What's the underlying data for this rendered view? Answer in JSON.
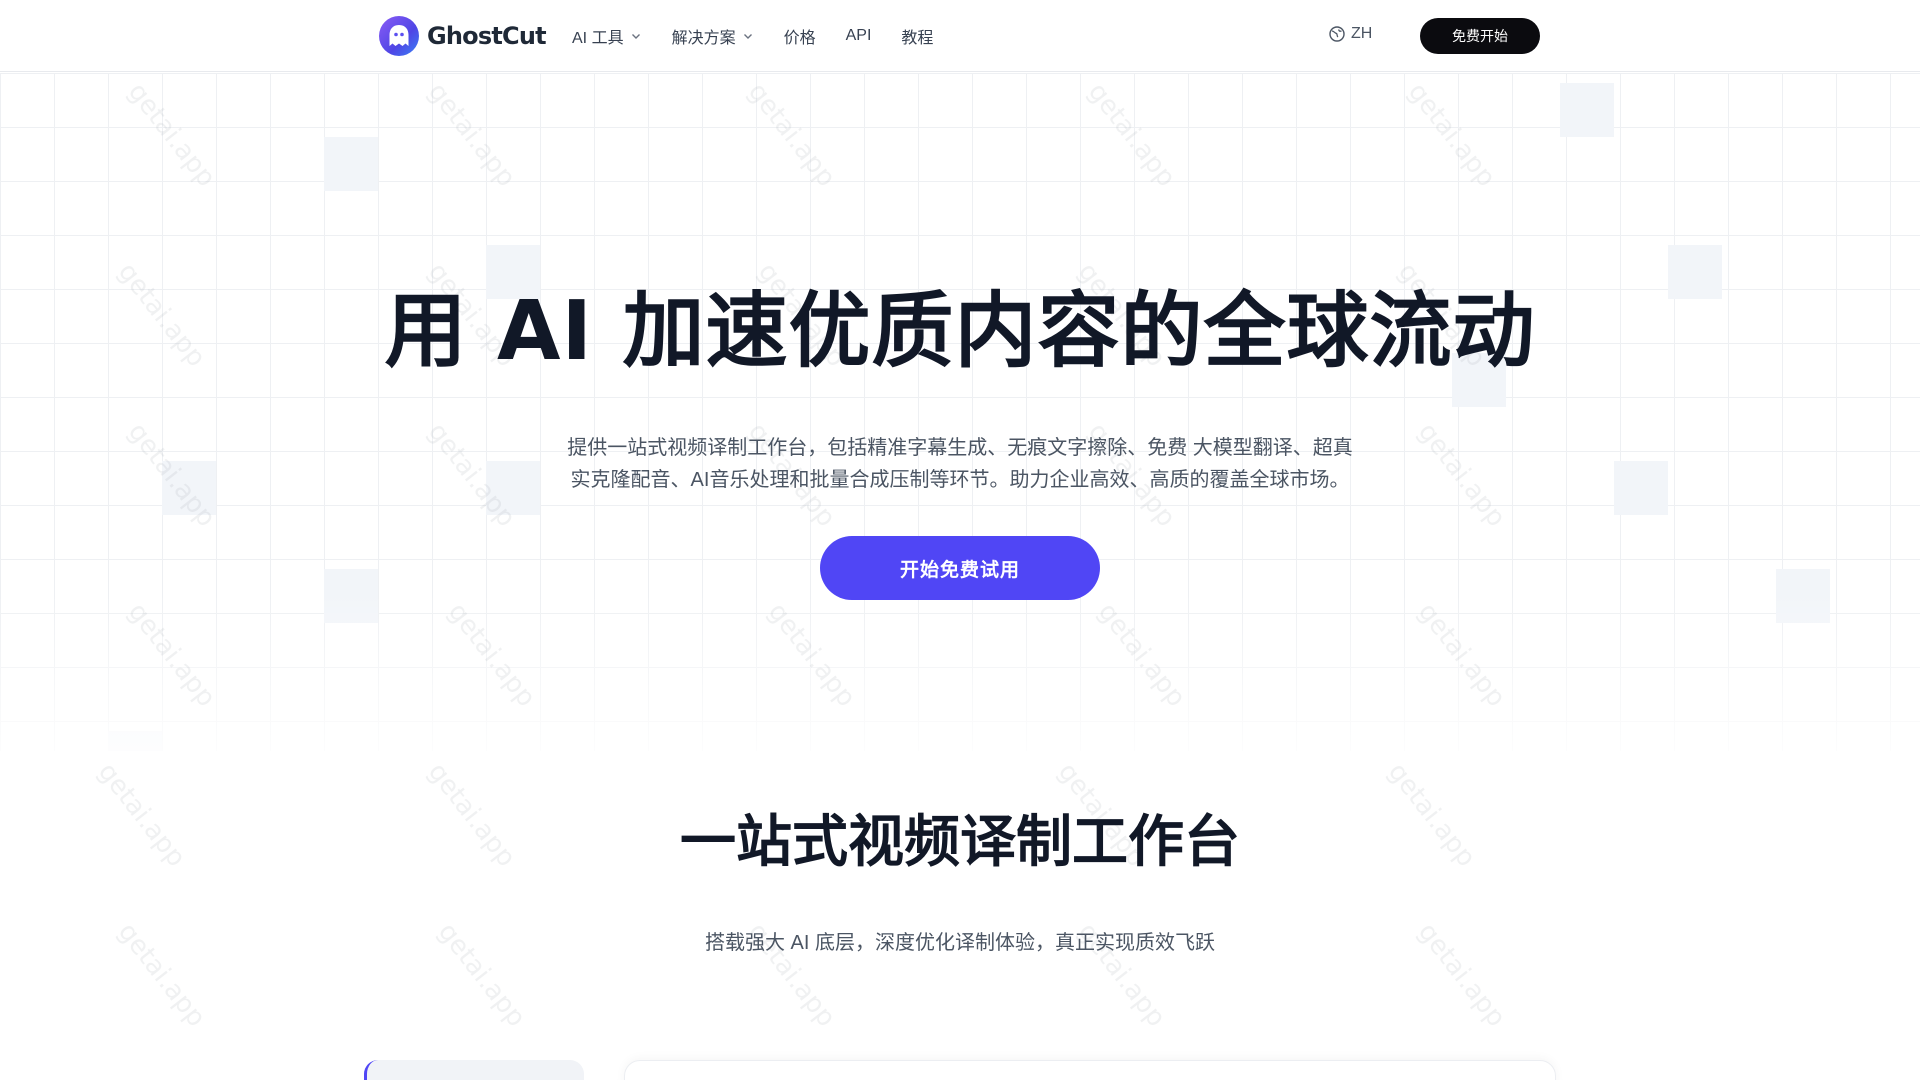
{
  "header": {
    "brand": "GhostCut",
    "nav": [
      {
        "label": "AI 工具",
        "has_dropdown": true
      },
      {
        "label": "解决方案",
        "has_dropdown": true
      },
      {
        "label": "价格",
        "has_dropdown": false
      },
      {
        "label": "API",
        "has_dropdown": false
      },
      {
        "label": "教程",
        "has_dropdown": false
      }
    ],
    "lang_label": "ZH",
    "lang_icon": "globe-icon",
    "cta_label": "免费开始"
  },
  "hero": {
    "title": "用 AI 加速优质内容的全球流动",
    "subtitle_line1": "提供一站式视频译制工作台，包括精准字幕生成、无痕文字擦除、免费 大模型翻译、超真",
    "subtitle_line2": "实克隆配音、AI音乐处理和批量合成压制等环节。助力企业高效、高质的覆盖全球市场。",
    "cta_label": "开始免费试用"
  },
  "section": {
    "title": "一站式视频译制工作台",
    "subtitle": "搭载强大 AI 底层，深度优化译制体验，真正实现质效飞跃"
  },
  "watermark": "getai.app",
  "colors": {
    "accent": "#5046f5",
    "dark_button": "#0b0b0f",
    "title_text": "#111827",
    "body_text": "#4b5563",
    "grid_line": "#eef0f3"
  }
}
